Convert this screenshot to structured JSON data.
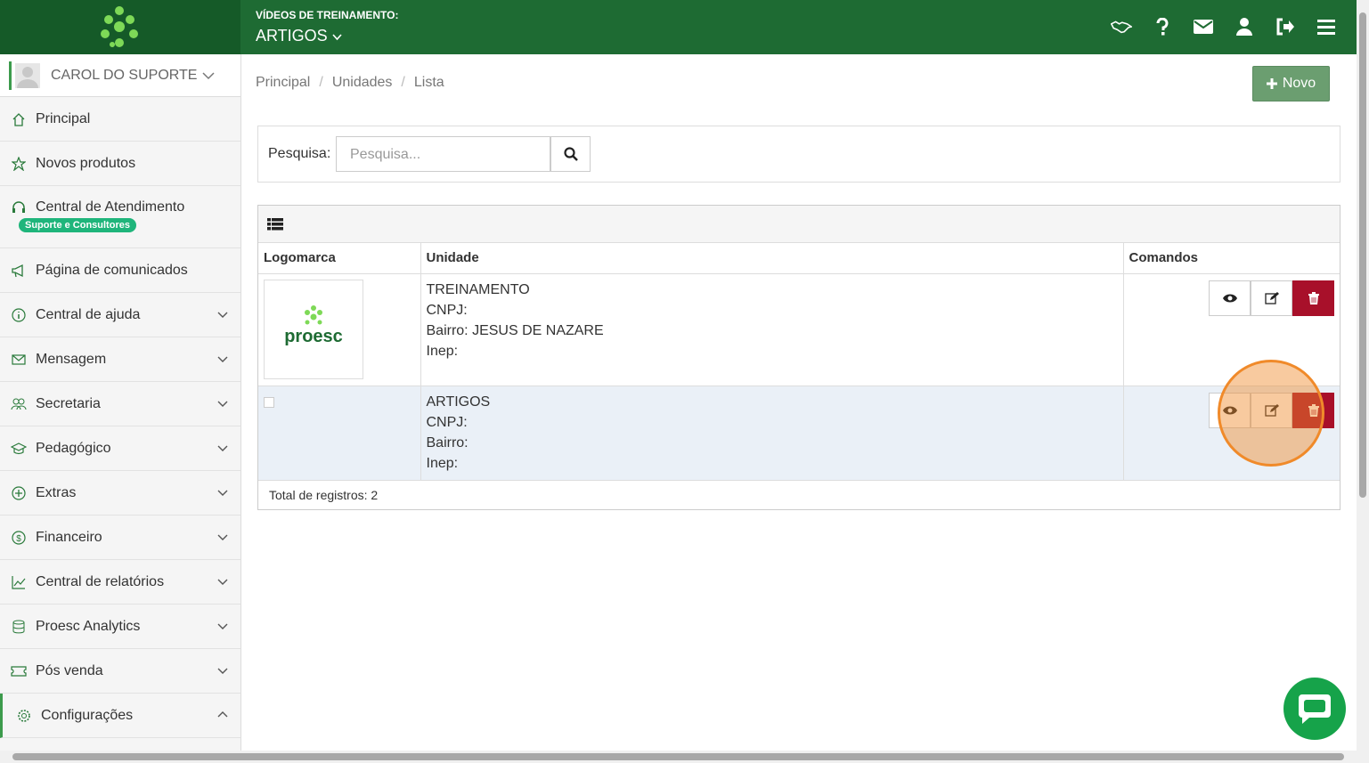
{
  "header": {
    "subtitle": "VÍDEOS DE TREINAMENTO:",
    "title": "ARTIGOS",
    "icons": [
      "handshake-icon",
      "help-icon",
      "mail-icon",
      "user-icon",
      "logout-icon",
      "menu-icon"
    ]
  },
  "user": {
    "name": "CAROL DO SUPORTE"
  },
  "sidebar": {
    "items": [
      {
        "label": "Principal",
        "icon": "home-icon"
      },
      {
        "label": "Novos produtos",
        "icon": "star-icon"
      },
      {
        "label": "Central de Atendimento",
        "icon": "headset-icon",
        "badge": "Suporte e Consultores"
      },
      {
        "label": "Página de comunicados",
        "icon": "megaphone-icon"
      },
      {
        "label": "Central de ajuda",
        "icon": "info-icon"
      },
      {
        "label": "Mensagem",
        "icon": "envelope-icon"
      },
      {
        "label": "Secretaria",
        "icon": "people-icon"
      },
      {
        "label": "Pedagógico",
        "icon": "graduation-icon"
      },
      {
        "label": "Extras",
        "icon": "plus-circle-icon"
      },
      {
        "label": "Financeiro",
        "icon": "dollar-icon"
      },
      {
        "label": "Central de relatórios",
        "icon": "chart-icon"
      },
      {
        "label": "Proesc Analytics",
        "icon": "database-icon"
      },
      {
        "label": "Pós venda",
        "icon": "ticket-icon"
      },
      {
        "label": "Configurações",
        "icon": "gear-icon"
      }
    ]
  },
  "breadcrumb": [
    "Principal",
    "Unidades",
    "Lista"
  ],
  "toolbar": {
    "new_label": "Novo"
  },
  "search": {
    "label": "Pesquisa:",
    "placeholder": "Pesquisa..."
  },
  "table": {
    "columns": [
      "Logomarca",
      "Unidade",
      "Comandos"
    ],
    "rows": [
      {
        "logo_text": "proesc",
        "lines": [
          "TREINAMENTO",
          "CNPJ:",
          "Bairro: JESUS DE NAZARE",
          "Inep:"
        ]
      },
      {
        "logo_text": "",
        "lines": [
          "ARTIGOS",
          "CNPJ:",
          "Bairro:",
          "Inep:"
        ]
      }
    ],
    "total": "Total de registros: 2"
  },
  "colors": {
    "header_bg": "#1e6b33",
    "accent": "#3c9b4c",
    "danger": "#a8102a",
    "highlight": "#f08a2a"
  }
}
